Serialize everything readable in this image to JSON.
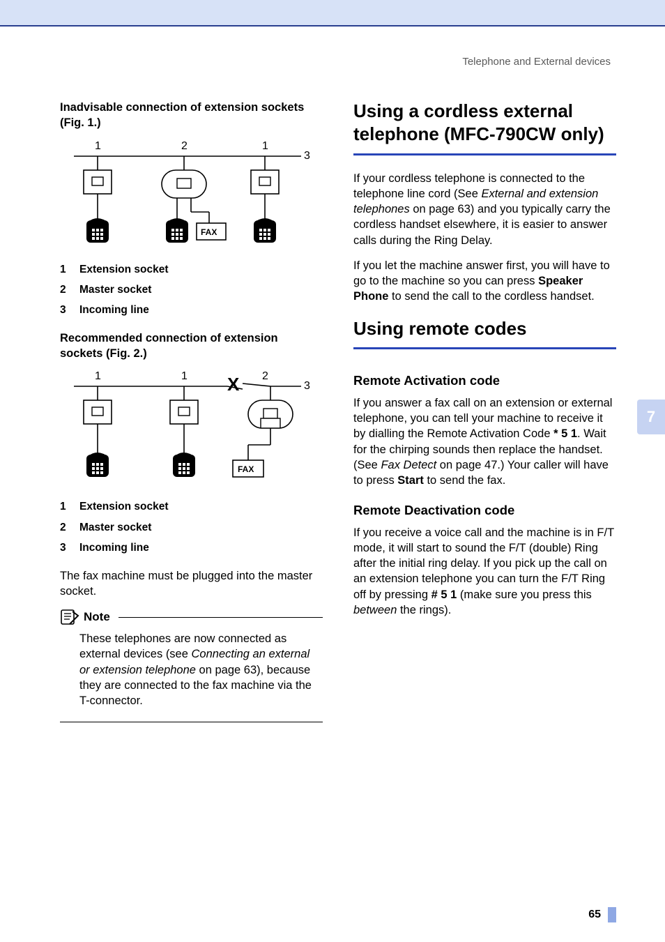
{
  "breadcrumb": "Telephone and External devices",
  "left": {
    "fig1_title": "Inadvisable connection of extension sockets (Fig. 1.)",
    "fig2_title": "Recommended connection of extension sockets (Fig. 2.)",
    "fax_label": "FAX",
    "legend": [
      {
        "n": "1",
        "label": "Extension socket"
      },
      {
        "n": "2",
        "label": "Master socket"
      },
      {
        "n": "3",
        "label": "Incoming line"
      }
    ],
    "must_plug": "The fax machine must be plugged into the master socket.",
    "note_title": "Note",
    "note_body_1": "These telephones are now connected as external devices (see ",
    "note_body_link": "Connecting an external or extension telephone",
    "note_body_2": " on page 63), because they are connected to the fax machine via the T-connector.",
    "fig1": {
      "labels": [
        "1",
        "2",
        "1",
        "3"
      ]
    },
    "fig2": {
      "labels": [
        "1",
        "1",
        "2",
        "3"
      ],
      "x_mark": "X"
    }
  },
  "right": {
    "h1_cordless": "Using a cordless external telephone (MFC-790CW only)",
    "cordless_p1_a": "If your cordless telephone is connected to the telephone line cord (See ",
    "cordless_p1_link": "External and extension telephones",
    "cordless_p1_b": " on page 63) and you typically carry the cordless handset elsewhere, it is easier to answer calls during the Ring Delay.",
    "cordless_p2_a": "If you let the machine answer first, you will have to go to the machine so you can press ",
    "cordless_p2_bold": "Speaker Phone",
    "cordless_p2_b": " to send the call to the cordless handset.",
    "h1_remote": "Using remote codes",
    "h2_activation": "Remote Activation code",
    "activation_a": "If you answer a fax call on an extension or external telephone, you can tell your machine to receive it by dialling the Remote Activation Code ",
    "activation_code": "* 5 1",
    "activation_b": ". Wait for the chirping sounds then replace the handset. (See ",
    "activation_link": "Fax Detect",
    "activation_c": " on page 47.) Your caller will have to press ",
    "activation_start": "Start",
    "activation_d": " to send the fax.",
    "h2_deactivation": "Remote Deactivation code",
    "deactivation_a": "If you receive a voice call and the machine is in F/T mode, it will start to sound the F/T (double) Ring after the initial ring delay. If you pick up the call on an extension telephone you can turn the F/T Ring off by pressing ",
    "deactivation_code": "# 5 1",
    "deactivation_b": " (make sure you press this ",
    "deactivation_between": "between",
    "deactivation_c": " the rings)."
  },
  "chapter_tab": "7",
  "page_number": "65"
}
